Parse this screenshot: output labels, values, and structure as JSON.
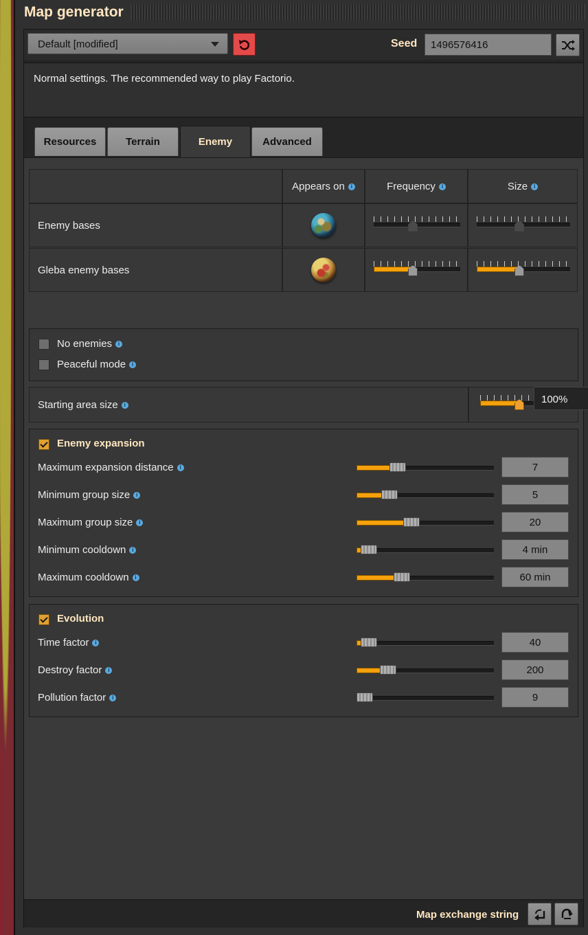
{
  "window": {
    "title": "Map generator"
  },
  "preset": {
    "selected": "Default [modified]"
  },
  "seed": {
    "label": "Seed",
    "value": "1496576416"
  },
  "description": "Normal settings. The recommended way to play Factorio.",
  "tabs": [
    {
      "label": "Resources",
      "active": false
    },
    {
      "label": "Terrain",
      "active": false
    },
    {
      "label": "Enemy",
      "active": true
    },
    {
      "label": "Advanced",
      "active": false
    }
  ],
  "enemy_table": {
    "headers": {
      "appears_on": "Appears on",
      "frequency": "Frequency",
      "size": "Size"
    },
    "rows": [
      {
        "label": "Enemy bases",
        "planet": "nauvis-planet-icon",
        "frequency": 0.5,
        "size": 0.5,
        "enabled": false
      },
      {
        "label": "Gleba enemy bases",
        "planet": "gleba-planet-icon",
        "frequency": 0.5,
        "size": 0.5,
        "enabled": true
      }
    ]
  },
  "toggles": [
    {
      "label": "No enemies",
      "checked": false
    },
    {
      "label": "Peaceful mode",
      "checked": false
    }
  ],
  "starting_area": {
    "label": "Starting area size",
    "level": 0.5,
    "tooltip": "100%"
  },
  "expansion": {
    "title": "Enemy expansion",
    "enabled": true,
    "items": [
      {
        "label": "Maximum expansion distance",
        "value": "7",
        "fill": 0.3
      },
      {
        "label": "Minimum group size",
        "value": "5",
        "fill": 0.24
      },
      {
        "label": "Maximum group size",
        "value": "20",
        "fill": 0.4
      },
      {
        "label": "Minimum cooldown",
        "value": "4 min",
        "fill": 0.04
      },
      {
        "label": "Maximum cooldown",
        "value": "60 min",
        "fill": 0.34
      }
    ]
  },
  "evolution": {
    "title": "Evolution",
    "enabled": true,
    "items": [
      {
        "label": "Time factor",
        "value": "40",
        "fill": 0.04
      },
      {
        "label": "Destroy factor",
        "value": "200",
        "fill": 0.24
      },
      {
        "label": "Pollution factor",
        "value": "9",
        "fill": 0.0
      }
    ]
  },
  "footer": {
    "map_exchange_label": "Map exchange string"
  },
  "colors": {
    "accent": "#f5a10c",
    "title": "#ffe6c0",
    "reset": "#e34a4a",
    "info": "#5aa9de"
  }
}
